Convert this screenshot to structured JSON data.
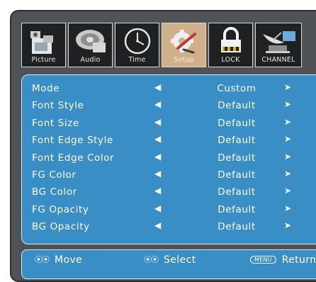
{
  "tabs": [
    {
      "label": "Picture",
      "icon": "picture-camera-icon",
      "active": false
    },
    {
      "label": "Audio",
      "icon": "audio-speaker-icon",
      "active": false
    },
    {
      "label": "Time",
      "icon": "clock-icon",
      "active": false
    },
    {
      "label": "Setup",
      "icon": "setup-tools-icon",
      "active": true
    },
    {
      "label": "LOCK",
      "icon": "padlock-icon",
      "active": false
    },
    {
      "label": "CHANNEL",
      "icon": "satellite-dish-icon",
      "active": false
    }
  ],
  "rows": [
    {
      "name": "Mode",
      "value": "Custom"
    },
    {
      "name": "Font Style",
      "value": "Default"
    },
    {
      "name": "Font Size",
      "value": "Default"
    },
    {
      "name": "Font Edge Style",
      "value": "Default"
    },
    {
      "name": "Font Edge Color",
      "value": "Default"
    },
    {
      "name": "FG Color",
      "value": "Default"
    },
    {
      "name": "BG Color",
      "value": "Default"
    },
    {
      "name": "FG Opacity",
      "value": "Default"
    },
    {
      "name": "BG Opacity",
      "value": "Default"
    }
  ],
  "arrows": {
    "left": "◀",
    "right": "➤"
  },
  "footer": {
    "move_glyph": "⦿⦿",
    "move_label": "Move",
    "select_glyph": "⦿⦿",
    "select_label": "Select",
    "menu_key": "MENU",
    "return_label": "Return"
  },
  "colors": {
    "panel": "#3a8ec6",
    "frame": "#4f5257",
    "active_tab": "#cfb08b",
    "tab": "#1f2022"
  }
}
